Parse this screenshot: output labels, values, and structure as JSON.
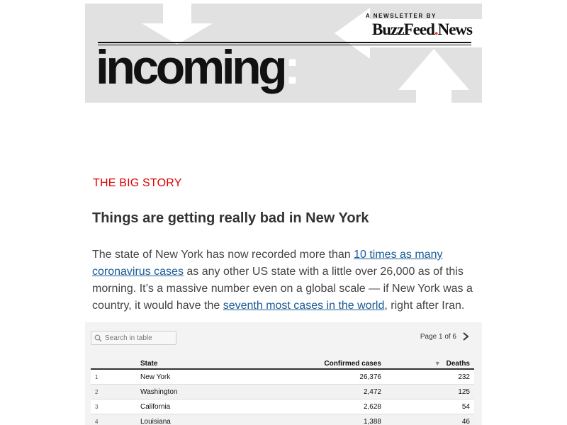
{
  "newsletter": {
    "tagline": "A NEWSLETTER BY",
    "brand_main": "BuzzFeed",
    "brand_dot": ".",
    "brand_end": "News",
    "wordmark": "incoming",
    "wordmark_colon": ":"
  },
  "article": {
    "kicker": "THE BIG STORY",
    "headline": "Things are getting really bad in New York",
    "body": {
      "part1": "The state of New York has now recorded more than ",
      "link1": "10 times as many coronavirus cases",
      "part2": " as any other US state with a little over 26,000 as of this morning. It’s a massive number even on a global scale — if New York was a country, it would have the ",
      "link2": "seventh most cases in the world",
      "part3": ", right after Iran."
    }
  },
  "table": {
    "search_placeholder": "Search in table",
    "pagination": "Page 1 of 6",
    "columns": {
      "rank": "",
      "state": "State",
      "cases": "Confirmed cases",
      "deaths": "Deaths"
    },
    "sort_indicator": "▼",
    "rows": [
      {
        "rank": "1",
        "state": "New York",
        "cases": "26,376",
        "deaths": "232"
      },
      {
        "rank": "2",
        "state": "Washington",
        "cases": "2,472",
        "deaths": "125"
      },
      {
        "rank": "3",
        "state": "California",
        "cases": "2,628",
        "deaths": "54"
      },
      {
        "rank": "4",
        "state": "Louisiana",
        "cases": "1,388",
        "deaths": "46"
      }
    ]
  },
  "icons": {
    "search": "search-icon",
    "next": "chevron-right-icon"
  },
  "colors": {
    "banner_bg": "#e1e1e1",
    "kicker": "#dd0000",
    "link": "#1a5a96",
    "brand_dot": "#ee3322"
  }
}
